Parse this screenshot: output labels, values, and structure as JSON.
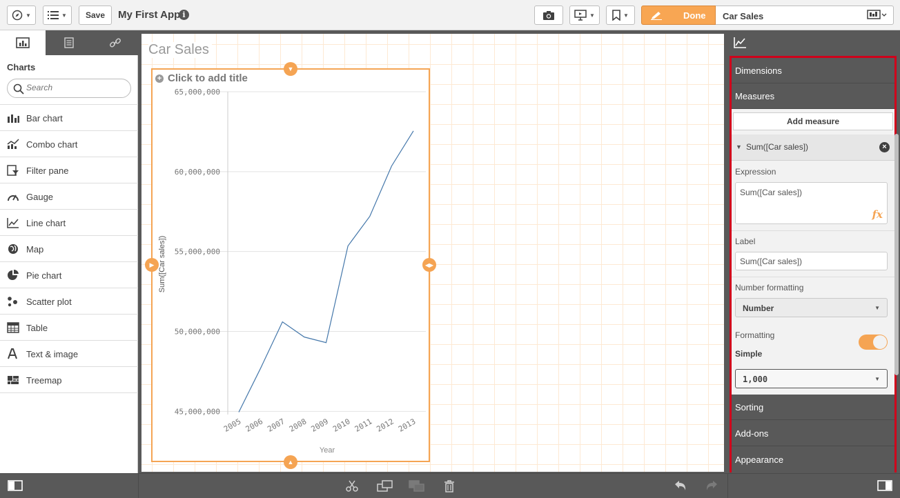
{
  "toolbar": {
    "save_label": "Save",
    "app_title": "My First App",
    "done_label": "Done",
    "sheet_name": "Car Sales",
    "icons": [
      "compass-icon",
      "list-menu-icon",
      "camera-icon",
      "presentation-icon",
      "bookmark-icon",
      "pencil-icon",
      "sheet-icon"
    ]
  },
  "left_panel": {
    "heading": "Charts",
    "search_placeholder": "Search",
    "items": [
      {
        "label": "Bar chart",
        "icon": "bar-chart-icon"
      },
      {
        "label": "Combo chart",
        "icon": "combo-chart-icon"
      },
      {
        "label": "Filter pane",
        "icon": "filter-pane-icon"
      },
      {
        "label": "Gauge",
        "icon": "gauge-icon"
      },
      {
        "label": "Line chart",
        "icon": "line-chart-icon"
      },
      {
        "label": "Map",
        "icon": "map-icon"
      },
      {
        "label": "Pie chart",
        "icon": "pie-chart-icon"
      },
      {
        "label": "Scatter plot",
        "icon": "scatter-plot-icon"
      },
      {
        "label": "Table",
        "icon": "table-icon"
      },
      {
        "label": "Text & image",
        "icon": "text-image-icon"
      },
      {
        "label": "Treemap",
        "icon": "treemap-icon"
      }
    ]
  },
  "canvas": {
    "sheet_title": "Car Sales",
    "chart_placeholder_title": "Click to add title"
  },
  "chart_data": {
    "type": "line",
    "x": [
      "2005",
      "2006",
      "2007",
      "2008",
      "2009",
      "2010",
      "2011",
      "2012",
      "2013"
    ],
    "series": [
      {
        "values": [
          44950000,
          47700000,
          50600000,
          49650000,
          49300000,
          55350000,
          57200000,
          60350000,
          62550000
        ]
      }
    ],
    "xlabel": "Year",
    "ylabel": "Sum([Car sales])",
    "ylim": [
      44800000,
      65000000
    ],
    "yticks": [
      "45,000,000",
      "50,000,000",
      "55,000,000",
      "60,000,000",
      "65,000,000"
    ],
    "ytick_values": [
      45000000,
      50000000,
      55000000,
      60000000,
      65000000
    ],
    "line_color": "#4477aa"
  },
  "properties": {
    "sections": {
      "dimensions": "Dimensions",
      "measures": "Measures",
      "sorting": "Sorting",
      "addons": "Add-ons",
      "appearance": "Appearance"
    },
    "add_measure": "Add measure",
    "measure_name": "Sum([Car sales])",
    "expression_label": "Expression",
    "expression_value": "Sum([Car sales])",
    "label_label": "Label",
    "label_value": "Sum([Car sales])",
    "number_formatting_label": "Number formatting",
    "number_formatting_value": "Number",
    "formatting_label": "Formatting",
    "formatting_mode": "Simple",
    "format_pattern": "1,000"
  },
  "colors": {
    "accent": "#f5a453",
    "highlight_frame": "#d0021b",
    "panel_dark": "#595959"
  }
}
